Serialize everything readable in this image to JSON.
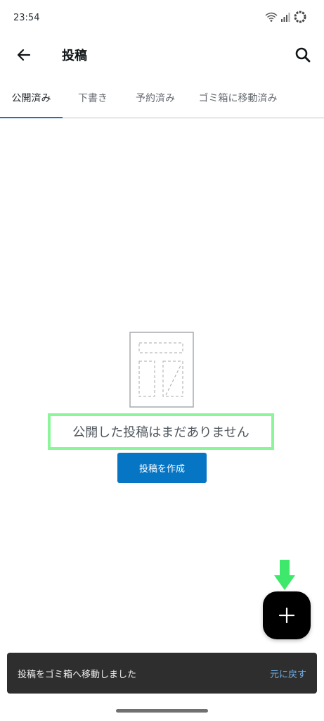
{
  "status_bar": {
    "time": "23:54",
    "icons": [
      "wifi-icon",
      "signal-icon",
      "loading-ring-icon"
    ]
  },
  "app_bar": {
    "title": "投稿",
    "back_icon": "arrow-left-icon",
    "search_icon": "search-icon"
  },
  "tabs": [
    {
      "label": "公開済み",
      "active": true
    },
    {
      "label": "下書き",
      "active": false
    },
    {
      "label": "予約済み",
      "active": false
    },
    {
      "label": "ゴミ箱に移動済み",
      "active": false
    }
  ],
  "empty_state": {
    "message": "公開した投稿はまだありません",
    "button_label": "投稿を作成",
    "illustration_icon": "empty-posts-illustration"
  },
  "fab": {
    "icon": "plus-icon"
  },
  "snackbar": {
    "message": "投稿をゴミ箱へ移動しました",
    "action_label": "元に戻す"
  },
  "colors": {
    "accent": "#2271b1",
    "button": "#0675c4",
    "highlight": "#8cf59c",
    "arrow": "#3ee86a",
    "snackbar_bg": "#2e2e2e",
    "snackbar_action": "#72aee6"
  }
}
